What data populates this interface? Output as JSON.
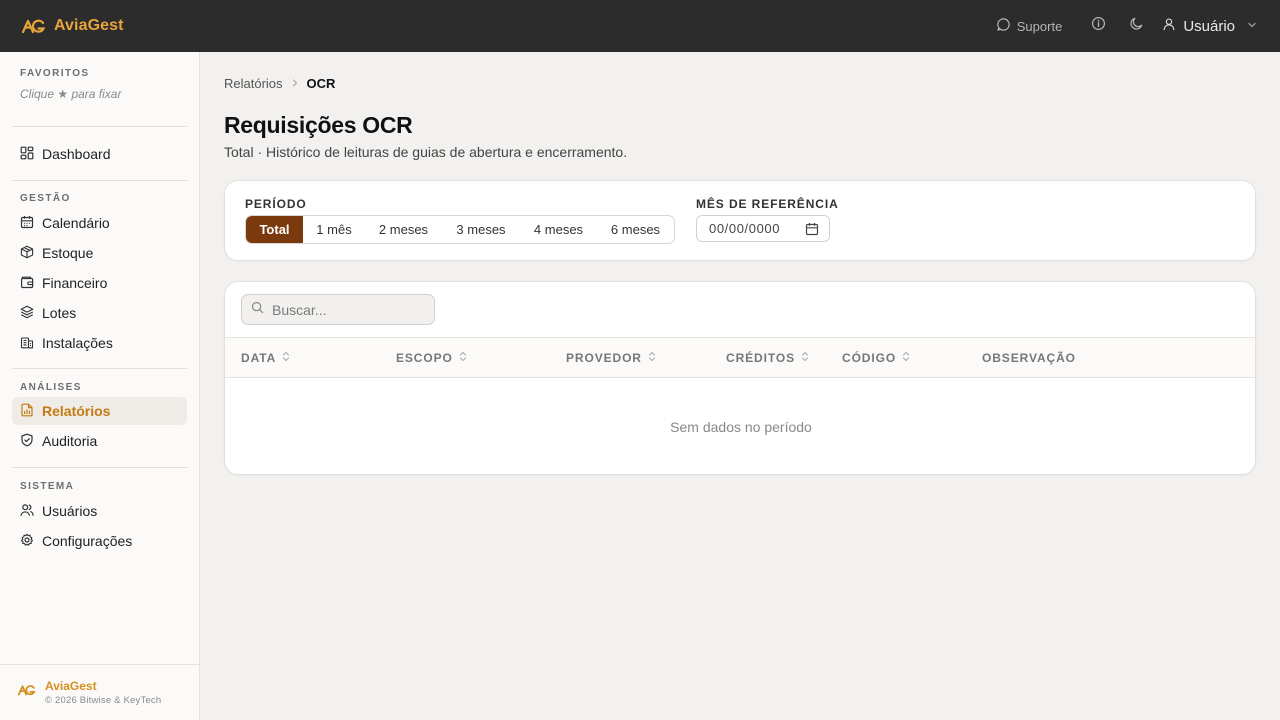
{
  "app": {
    "name": "AviaGest"
  },
  "topbar": {
    "support_label": "Suporte",
    "user_label": "Usuário"
  },
  "sidebar": {
    "favorites": {
      "title": "FAVORITOS",
      "hint": "Clique ★ para fixar"
    },
    "dashboard": {
      "label": "Dashboard"
    },
    "sections": [
      {
        "title": "GESTÃO",
        "items": [
          {
            "label": "Calendário",
            "icon": "calendar-icon"
          },
          {
            "label": "Estoque",
            "icon": "box-icon"
          },
          {
            "label": "Financeiro",
            "icon": "wallet-icon"
          },
          {
            "label": "Lotes",
            "icon": "layers-icon"
          },
          {
            "label": "Instalações",
            "icon": "building-icon"
          }
        ]
      },
      {
        "title": "ANÁLISES",
        "items": [
          {
            "label": "Relatórios",
            "icon": "report-icon",
            "active": true
          },
          {
            "label": "Auditoria",
            "icon": "shield-check-icon"
          }
        ]
      },
      {
        "title": "SISTEMA",
        "items": [
          {
            "label": "Usuários",
            "icon": "users-icon"
          },
          {
            "label": "Configurações",
            "icon": "gear-icon"
          }
        ]
      }
    ],
    "footer": {
      "name": "AviaGest",
      "copyright": "© 2026 Bitwise & KeyTech"
    }
  },
  "breadcrumb": {
    "parent": "Relatórios",
    "current": "OCR"
  },
  "page": {
    "title": "Requisições OCR",
    "subtitle": "Total · Histórico de leituras de guias de abertura e encerramento."
  },
  "filters": {
    "period_label": "PERÍODO",
    "period_options": [
      "Total",
      "1 mês",
      "2 meses",
      "3 meses",
      "4 meses",
      "6 meses"
    ],
    "period_selected": "Total",
    "month_label": "MÊS DE REFERÊNCIA",
    "month_value": "00/00/0000"
  },
  "table": {
    "search_placeholder": "Buscar...",
    "columns": [
      "DATA",
      "ESCOPO",
      "PROVEDOR",
      "CRÉDITOS",
      "CÓDIGO",
      "OBSERVAÇÃO"
    ],
    "empty_message": "Sem dados no período"
  },
  "colors": {
    "brand": "#e8a33a",
    "active_nav": "#c47a12",
    "segment_active": "#7a3a0e",
    "topbar": "#2c2c2c"
  }
}
